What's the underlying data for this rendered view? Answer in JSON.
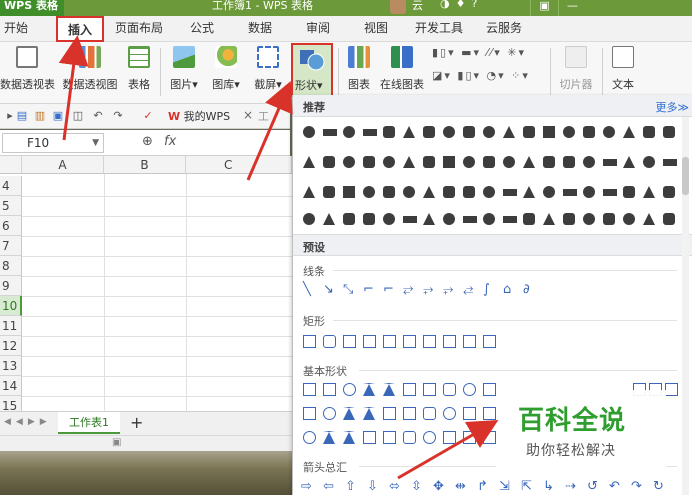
{
  "titlebar": {
    "app_name": "WPS 表格",
    "doc_title": "工作簿1 - WPS 表格",
    "user": "云"
  },
  "menu": {
    "items": [
      "开始",
      "插入",
      "页面布局",
      "公式",
      "数据",
      "审阅",
      "视图",
      "开发工具",
      "云服务"
    ],
    "active": "插入"
  },
  "toolbar": {
    "pivot_table": "数据透视表",
    "pivot_chart": "数据透视图",
    "table": "表格",
    "picture": "图片",
    "gallery": "图库",
    "screenshot": "截屏",
    "shapes": "形状",
    "chart": "图表",
    "online_chart": "在线图表",
    "slicer": "切片器",
    "text": "文本"
  },
  "tabbar": {
    "my_wps": "我的WPS",
    "close": "×",
    "workbook_tab": "工"
  },
  "formula": {
    "cell_ref": "F10",
    "fx": "fx"
  },
  "sheet": {
    "columns": [
      "A",
      "B",
      "C"
    ],
    "rows": [
      "4",
      "5",
      "6",
      "7",
      "8",
      "9",
      "10",
      "11",
      "12",
      "13",
      "14",
      "15"
    ],
    "selected_row": "10"
  },
  "sheet_tabs": {
    "active": "工作表1",
    "add": "+"
  },
  "shapes_panel": {
    "recommended": "推荐",
    "more": "更多≫",
    "presets": "预设",
    "cat_lines": "线条",
    "cat_rect": "矩形",
    "cat_basic": "基本形状",
    "cat_arrows": "箭头总汇"
  },
  "watermark": {
    "title": "百科全说",
    "subtitle": "助你轻松解决"
  },
  "colors": {
    "accent": "#4a9a3b",
    "highlight": "#d9322b",
    "shape_outline": "#3a67b8"
  }
}
